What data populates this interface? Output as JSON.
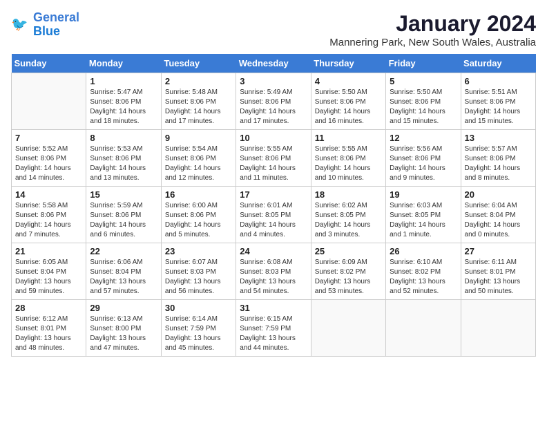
{
  "logo": {
    "line1": "General",
    "line2": "Blue"
  },
  "title": "January 2024",
  "subtitle": "Mannering Park, New South Wales, Australia",
  "weekdays": [
    "Sunday",
    "Monday",
    "Tuesday",
    "Wednesday",
    "Thursday",
    "Friday",
    "Saturday"
  ],
  "weeks": [
    [
      {
        "day": "",
        "info": ""
      },
      {
        "day": "1",
        "info": "Sunrise: 5:47 AM\nSunset: 8:06 PM\nDaylight: 14 hours\nand 18 minutes."
      },
      {
        "day": "2",
        "info": "Sunrise: 5:48 AM\nSunset: 8:06 PM\nDaylight: 14 hours\nand 17 minutes."
      },
      {
        "day": "3",
        "info": "Sunrise: 5:49 AM\nSunset: 8:06 PM\nDaylight: 14 hours\nand 17 minutes."
      },
      {
        "day": "4",
        "info": "Sunrise: 5:50 AM\nSunset: 8:06 PM\nDaylight: 14 hours\nand 16 minutes."
      },
      {
        "day": "5",
        "info": "Sunrise: 5:50 AM\nSunset: 8:06 PM\nDaylight: 14 hours\nand 15 minutes."
      },
      {
        "day": "6",
        "info": "Sunrise: 5:51 AM\nSunset: 8:06 PM\nDaylight: 14 hours\nand 15 minutes."
      }
    ],
    [
      {
        "day": "7",
        "info": "Sunrise: 5:52 AM\nSunset: 8:06 PM\nDaylight: 14 hours\nand 14 minutes."
      },
      {
        "day": "8",
        "info": "Sunrise: 5:53 AM\nSunset: 8:06 PM\nDaylight: 14 hours\nand 13 minutes."
      },
      {
        "day": "9",
        "info": "Sunrise: 5:54 AM\nSunset: 8:06 PM\nDaylight: 14 hours\nand 12 minutes."
      },
      {
        "day": "10",
        "info": "Sunrise: 5:55 AM\nSunset: 8:06 PM\nDaylight: 14 hours\nand 11 minutes."
      },
      {
        "day": "11",
        "info": "Sunrise: 5:55 AM\nSunset: 8:06 PM\nDaylight: 14 hours\nand 10 minutes."
      },
      {
        "day": "12",
        "info": "Sunrise: 5:56 AM\nSunset: 8:06 PM\nDaylight: 14 hours\nand 9 minutes."
      },
      {
        "day": "13",
        "info": "Sunrise: 5:57 AM\nSunset: 8:06 PM\nDaylight: 14 hours\nand 8 minutes."
      }
    ],
    [
      {
        "day": "14",
        "info": "Sunrise: 5:58 AM\nSunset: 8:06 PM\nDaylight: 14 hours\nand 7 minutes."
      },
      {
        "day": "15",
        "info": "Sunrise: 5:59 AM\nSunset: 8:06 PM\nDaylight: 14 hours\nand 6 minutes."
      },
      {
        "day": "16",
        "info": "Sunrise: 6:00 AM\nSunset: 8:06 PM\nDaylight: 14 hours\nand 5 minutes."
      },
      {
        "day": "17",
        "info": "Sunrise: 6:01 AM\nSunset: 8:05 PM\nDaylight: 14 hours\nand 4 minutes."
      },
      {
        "day": "18",
        "info": "Sunrise: 6:02 AM\nSunset: 8:05 PM\nDaylight: 14 hours\nand 3 minutes."
      },
      {
        "day": "19",
        "info": "Sunrise: 6:03 AM\nSunset: 8:05 PM\nDaylight: 14 hours\nand 1 minute."
      },
      {
        "day": "20",
        "info": "Sunrise: 6:04 AM\nSunset: 8:04 PM\nDaylight: 14 hours\nand 0 minutes."
      }
    ],
    [
      {
        "day": "21",
        "info": "Sunrise: 6:05 AM\nSunset: 8:04 PM\nDaylight: 13 hours\nand 59 minutes."
      },
      {
        "day": "22",
        "info": "Sunrise: 6:06 AM\nSunset: 8:04 PM\nDaylight: 13 hours\nand 57 minutes."
      },
      {
        "day": "23",
        "info": "Sunrise: 6:07 AM\nSunset: 8:03 PM\nDaylight: 13 hours\nand 56 minutes."
      },
      {
        "day": "24",
        "info": "Sunrise: 6:08 AM\nSunset: 8:03 PM\nDaylight: 13 hours\nand 54 minutes."
      },
      {
        "day": "25",
        "info": "Sunrise: 6:09 AM\nSunset: 8:02 PM\nDaylight: 13 hours\nand 53 minutes."
      },
      {
        "day": "26",
        "info": "Sunrise: 6:10 AM\nSunset: 8:02 PM\nDaylight: 13 hours\nand 52 minutes."
      },
      {
        "day": "27",
        "info": "Sunrise: 6:11 AM\nSunset: 8:01 PM\nDaylight: 13 hours\nand 50 minutes."
      }
    ],
    [
      {
        "day": "28",
        "info": "Sunrise: 6:12 AM\nSunset: 8:01 PM\nDaylight: 13 hours\nand 48 minutes."
      },
      {
        "day": "29",
        "info": "Sunrise: 6:13 AM\nSunset: 8:00 PM\nDaylight: 13 hours\nand 47 minutes."
      },
      {
        "day": "30",
        "info": "Sunrise: 6:14 AM\nSunset: 7:59 PM\nDaylight: 13 hours\nand 45 minutes."
      },
      {
        "day": "31",
        "info": "Sunrise: 6:15 AM\nSunset: 7:59 PM\nDaylight: 13 hours\nand 44 minutes."
      },
      {
        "day": "",
        "info": ""
      },
      {
        "day": "",
        "info": ""
      },
      {
        "day": "",
        "info": ""
      }
    ]
  ]
}
